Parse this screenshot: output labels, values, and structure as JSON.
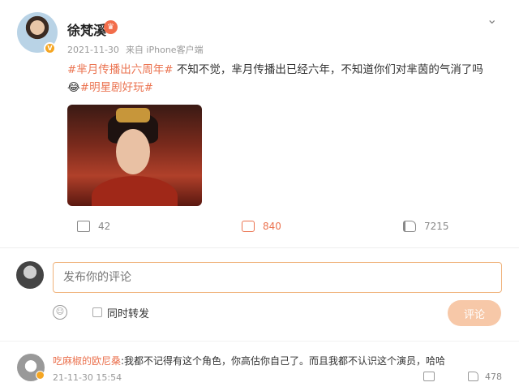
{
  "post": {
    "author": "徐梵溪",
    "date": "2021-11-30",
    "source": "来自 iPhone客户端",
    "hashtag1": "#芈月传播出六周年#",
    "body": " 不知不觉，芈月传播出已经六年，不知道你们对芈茵的气消了吗",
    "emoji": "😂",
    "hashtag2": "#明星剧好玩#"
  },
  "actions": {
    "share_count": "42",
    "comment_count": "840",
    "like_count": "7215"
  },
  "composer": {
    "placeholder": "发布你的评论",
    "repost_label": "同时转发",
    "submit_label": "评论"
  },
  "comment": {
    "user": "吃麻椒的欧尼桑",
    "text": ":我都不记得有这个角色，你高估你自己了。而且我都不认识这个演员，哈哈",
    "time": "21-11-30 15:54",
    "likes": "478"
  },
  "colors": {
    "accent": "#eb7350",
    "submit_bg": "#f7c8a8",
    "input_border": "#f0b27a"
  }
}
